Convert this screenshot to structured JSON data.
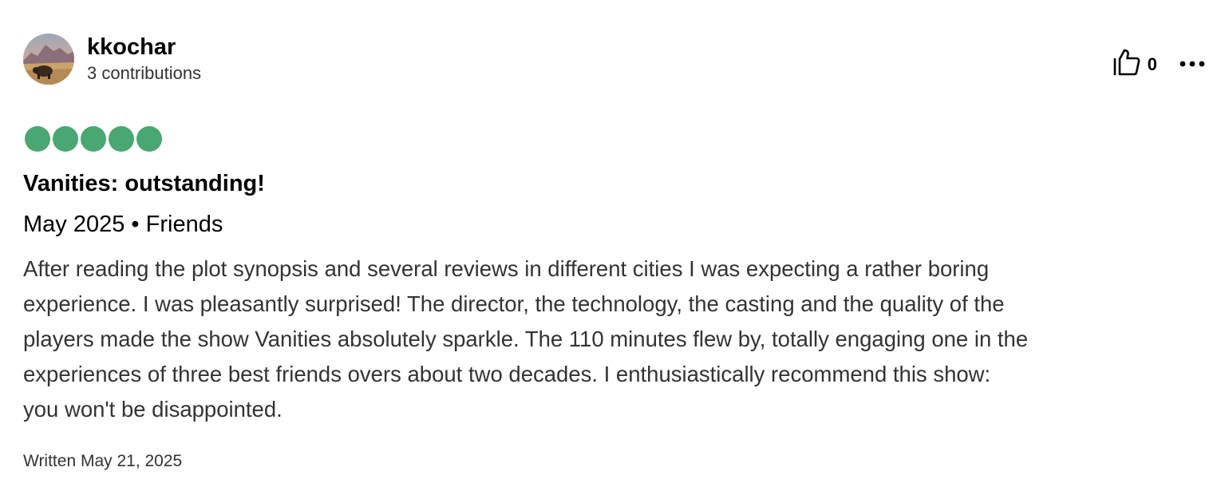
{
  "author": {
    "username": "kkochar",
    "contributions": "3 contributions"
  },
  "actions": {
    "helpful_icon": "thumbs-up-icon",
    "helpful_count": "0",
    "more_icon": "more-horizontal-icon"
  },
  "rating": {
    "value": 5,
    "max": 5,
    "bubble_color": "#4aa672"
  },
  "review": {
    "title": "Vanities: outstanding!",
    "trip_info": "May 2025 • Friends",
    "body": "After reading the plot synopsis and several reviews in different cities I was expecting a rather boring\nexperience. I was pleasantly surprised! The director, the technology, the casting and the quality of the\nplayers made the show Vanities absolutely sparkle. The 110 minutes flew by, totally engaging one in the\nexperiences of three best friends overs about two decades. I enthusiastically recommend this show:\nyou won't be disappointed.",
    "written_date": "Written May 21, 2025"
  }
}
